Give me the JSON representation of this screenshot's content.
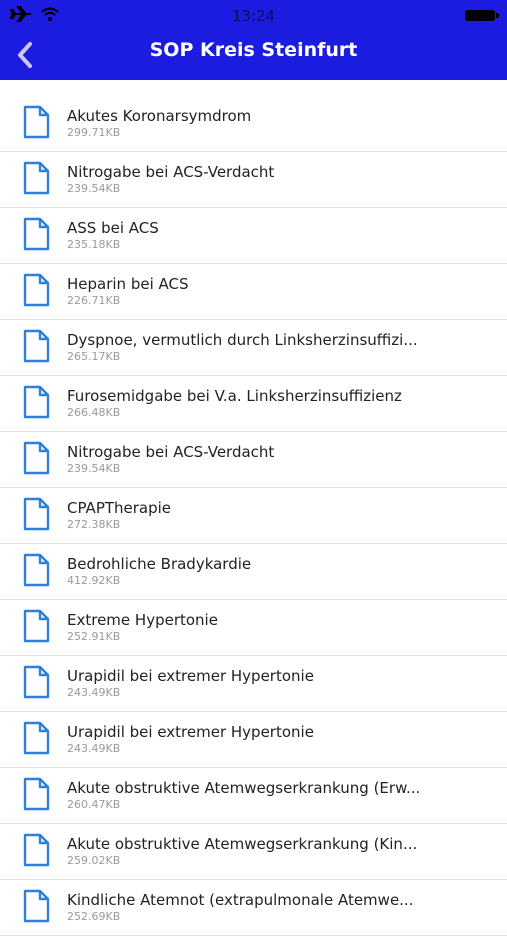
{
  "status": {
    "time": "13:24"
  },
  "nav": {
    "title": "SOP Kreis Steinfurt"
  },
  "files": [
    {
      "title": "Akutes Koronarsymdrom",
      "size": "299.71KB"
    },
    {
      "title": "Nitrogabe bei ACS-Verdacht",
      "size": "239.54KB"
    },
    {
      "title": "ASS bei ACS",
      "size": "235.18KB"
    },
    {
      "title": "Heparin bei ACS",
      "size": "226.71KB"
    },
    {
      "title": "Dyspnoe, vermutlich durch Linksherzinsuffizi...",
      "size": "265.17KB"
    },
    {
      "title": "Furosemidgabe bei V.a. Linksherzinsuffizienz",
      "size": "266.48KB"
    },
    {
      "title": "Nitrogabe bei ACS-Verdacht",
      "size": "239.54KB"
    },
    {
      "title": "CPAPTherapie",
      "size": "272.38KB"
    },
    {
      "title": "Bedrohliche Bradykardie",
      "size": "412.92KB"
    },
    {
      "title": "Extreme Hypertonie",
      "size": "252.91KB"
    },
    {
      "title": "Urapidil bei extremer Hypertonie",
      "size": "243.49KB"
    },
    {
      "title": "Urapidil bei extremer Hypertonie",
      "size": "243.49KB"
    },
    {
      "title": "Akute obstruktive Atemwegserkrankung (Erw...",
      "size": "260.47KB"
    },
    {
      "title": "Akute obstruktive Atemwegserkrankung (Kin...",
      "size": "259.02KB"
    },
    {
      "title": "Kindliche Atemnot (extrapulmonale Atemwe...",
      "size": "252.69KB"
    }
  ],
  "colors": {
    "accent": "#1c1ce0",
    "icon": "#2f7fe0"
  }
}
